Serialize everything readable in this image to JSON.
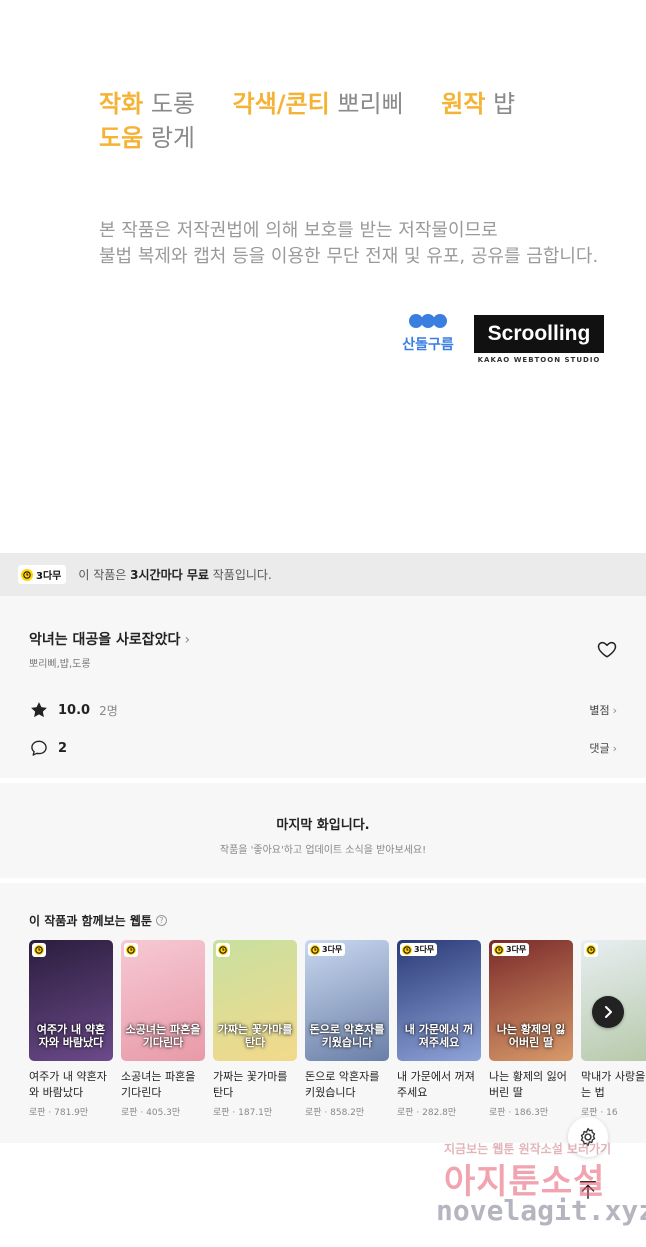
{
  "credits": {
    "line1": [
      {
        "role": "작화",
        "name": "도롱"
      },
      {
        "role": "각색/콘티",
        "name": "뽀리삐"
      },
      {
        "role": "원작",
        "name": "뱝"
      }
    ],
    "line2": [
      {
        "role": "도움",
        "name": "랑게"
      }
    ],
    "copyright_1": "본 작품은 저작권법에 의해 보호를 받는 저작물이므로",
    "copyright_2": "불법 복제와 캡처 등을 이용한 무단 전재 및 유포, 공유를 금합니다.",
    "logo_sandol": "산돌구름",
    "logo_scrolling": "Scroolling",
    "logo_scrolling_sub": "KAKAO WEBTOON STUDIO"
  },
  "free_bar": {
    "badge": "3다무",
    "text_pre": "이 작품은 ",
    "text_bold": "3시간마다 무료",
    "text_post": " 작품입니다."
  },
  "work": {
    "title": "악녀는 대공을 사로잡았다",
    "authors": "뽀리삐,뱝,도롱",
    "score": "10.0",
    "rating_count": "2명",
    "rate_link": "별점",
    "comment_count": "2",
    "comment_link": "댓글"
  },
  "last_episode": {
    "title": "마지막 화입니다.",
    "subtitle": "작품을 '좋아요'하고 업데이트 소식을 받아보세요!"
  },
  "recommendations": {
    "title": "이 작품과 함께보는 웹툰",
    "help": "?",
    "items": [
      {
        "name": "여주가 내 약혼자와 바람났다",
        "cover_text": "여주가 내 약혼자와 바람났다",
        "meta": "로판 · 781.9만",
        "badge": "",
        "colors": [
          "#2b1d3d",
          "#6b4a8a"
        ]
      },
      {
        "name": "소공녀는 파혼을 기다린다",
        "cover_text": "소공녀는 파혼을 기다린다",
        "meta": "로판 · 405.3만",
        "badge": "",
        "colors": [
          "#f6c9d4",
          "#e89aa8"
        ]
      },
      {
        "name": "가짜는 꽃가마를 탄다",
        "cover_text": "가짜는 꽃가마를 탄다",
        "meta": "로판 · 187.1만",
        "badge": "",
        "colors": [
          "#c8e0a0",
          "#f3d98a"
        ]
      },
      {
        "name": "돈으로 악혼자를 키웠습니다",
        "cover_text": "돈으로 악혼자를 키웠습니다",
        "meta": "로판 · 858.2만",
        "badge": "3다무",
        "colors": [
          "#c9d8ef",
          "#6a7fa8"
        ]
      },
      {
        "name": "내 가문에서 꺼져주세요",
        "cover_text": "내 가문에서 꺼져주세요",
        "meta": "로판 · 282.8만",
        "badge": "3다무",
        "colors": [
          "#2a3a78",
          "#8fa4d8"
        ]
      },
      {
        "name": "나는 황제의 잃어버린 딸",
        "cover_text": "나는 황제의 잃어버린 딸",
        "meta": "로판 · 186.3만",
        "badge": "3다무",
        "colors": [
          "#7a2a2a",
          "#d89a6a"
        ]
      },
      {
        "name": "막내가 사랑을 막는 법",
        "cover_text": "",
        "meta": "로판 · 16",
        "badge": "",
        "colors": [
          "#e8eef2",
          "#b5c8a8"
        ]
      }
    ]
  },
  "watermark": {
    "line1": "지금보는 웹툰 원작소설 보러가기",
    "line2": "아지툰소설",
    "line3": "novelagit.xyz"
  },
  "colors": {
    "role": "#f5b336",
    "accent_yellow": "#ffd400",
    "brand_blue": "#3a7ee0"
  },
  "icons": [
    "clock-icon",
    "chevron-right-icon",
    "heart-outline-icon",
    "star-icon",
    "comment-icon",
    "help-icon",
    "settings-icon",
    "scroll-top-icon"
  ]
}
